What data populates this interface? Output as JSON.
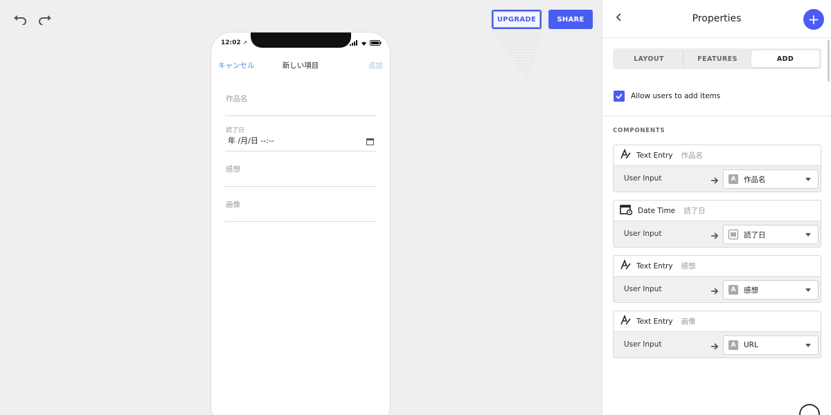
{
  "toolbar": {
    "undo_icon": "undo-icon",
    "redo_icon": "redo-icon",
    "upgrade_label": "UPGRADE",
    "share_label": "SHARE"
  },
  "phone": {
    "time": "12:02",
    "nav": {
      "cancel": "キャンセル",
      "title": "新しい項目",
      "add": "追加"
    },
    "fields": {
      "title_placeholder": "作品名",
      "date_label": "読了日",
      "date_value": "年 /月/日 --:--",
      "impression_placeholder": "感想",
      "image_placeholder": "画像"
    }
  },
  "panel": {
    "title": "Properties",
    "tabs": [
      "LAYOUT",
      "FEATURES",
      "ADD"
    ],
    "active_tab": "ADD",
    "allow_label": "Allow users to add items",
    "allow_checked": true,
    "components_label": "COMPONENTS",
    "components": [
      {
        "icon": "text-entry-icon",
        "type": "Text Entry",
        "name": "作品名",
        "input_label": "User Input",
        "badge": "A",
        "value": "作品名"
      },
      {
        "icon": "calendar-icon",
        "type": "Date Time",
        "name": "読了日",
        "input_label": "User Input",
        "badge": "grid",
        "value": "読了日"
      },
      {
        "icon": "text-entry-icon",
        "type": "Text Entry",
        "name": "感想",
        "input_label": "User Input",
        "badge": "A",
        "value": "感想"
      },
      {
        "icon": "text-entry-icon",
        "type": "Text Entry",
        "name": "画像",
        "input_label": "User Input",
        "badge": "A",
        "value": "URL"
      }
    ]
  },
  "colors": {
    "accent": "#4a5df2",
    "link": "#4a90e2"
  }
}
